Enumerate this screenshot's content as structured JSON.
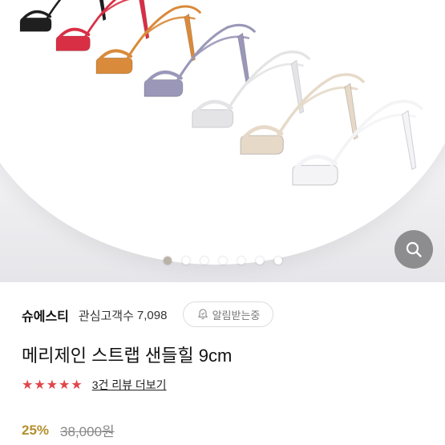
{
  "brand": {
    "name": "슈에스티",
    "follower_label": "관심고객수",
    "follower_count": "7,098",
    "notify_label": "알림받는중"
  },
  "product": {
    "title": "메리제인 스트랩 샌들힐 9cm",
    "rating": 5,
    "rating_max": 5,
    "review_link": "3건 리뷰 더보기",
    "discount": "25%",
    "original_price": "38,000원"
  },
  "gallery": {
    "slide_count": 7,
    "active_slide": 1,
    "zoom_icon": "search-icon",
    "sandal_colors": [
      "#1f1f1f",
      "#d92f45",
      "#d98a3a",
      "#9a97b8",
      "#e4e4e6",
      "#e6d9c8",
      "#f4f4f6"
    ]
  },
  "colors": {
    "star": "#e0464a",
    "discount": "#b58f2e"
  }
}
